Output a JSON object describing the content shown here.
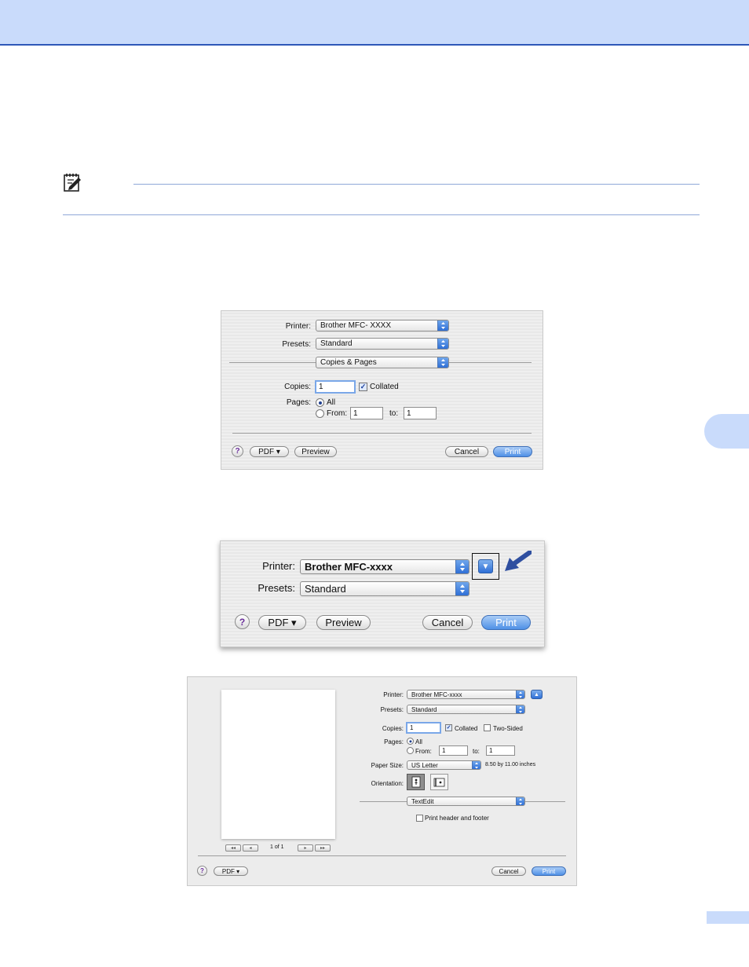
{
  "dialog1": {
    "printer_label": "Printer:",
    "printer_value": "Brother MFC- XXXX",
    "presets_label": "Presets:",
    "presets_value": "Standard",
    "section_value": "Copies & Pages",
    "copies_label": "Copies:",
    "copies_value": "1",
    "collated_label": "Collated",
    "pages_label": "Pages:",
    "all_label": "All",
    "from_label": "From:",
    "from_value": "1",
    "to_label": "to:",
    "to_value": "1",
    "help_label": "?",
    "pdf_label": "PDF ▾",
    "preview_label": "Preview",
    "cancel_label": "Cancel",
    "print_label": "Print"
  },
  "dialog2": {
    "printer_label": "Printer:",
    "printer_value": "Brother MFC-xxxx",
    "presets_label": "Presets:",
    "presets_value": "Standard",
    "disclosure_glyph": "▼",
    "help_label": "?",
    "pdf_label": "PDF ▾",
    "preview_label": "Preview",
    "cancel_label": "Cancel",
    "print_label": "Print"
  },
  "dialog3": {
    "page_indicator": "1 of 1",
    "nav_first": "◂◂",
    "nav_prev": "◂",
    "nav_next": "▸",
    "nav_last": "▸▸",
    "printer_label": "Printer:",
    "printer_value": "Brother MFC-xxxx",
    "presets_label": "Presets:",
    "presets_value": "Standard",
    "copies_label": "Copies:",
    "copies_value": "1",
    "collated_label": "Collated",
    "two_sided_label": "Two-Sided",
    "pages_label": "Pages:",
    "all_label": "All",
    "from_label": "From:",
    "from_value": "1",
    "to_label": "to:",
    "to_value": "1",
    "paper_size_label": "Paper Size:",
    "paper_size_value": "US Letter",
    "paper_dims": "8.50 by 11.00 inches",
    "orientation_label": "Orientation:",
    "section_value": "TextEdit",
    "header_footer_label": "Print header and footer",
    "disclosure_glyph": "▲",
    "help_label": "?",
    "pdf_label": "PDF ▾",
    "cancel_label": "Cancel",
    "print_label": "Print"
  },
  "colors": {
    "band": "#c9dbfb",
    "band_rule": "#2e58b8",
    "arrow": "#2f4fa0"
  },
  "icons": [
    "note-icon",
    "popup-arrow-icon",
    "arrow-pointer-icon",
    "portrait-icon",
    "landscape-icon"
  ]
}
